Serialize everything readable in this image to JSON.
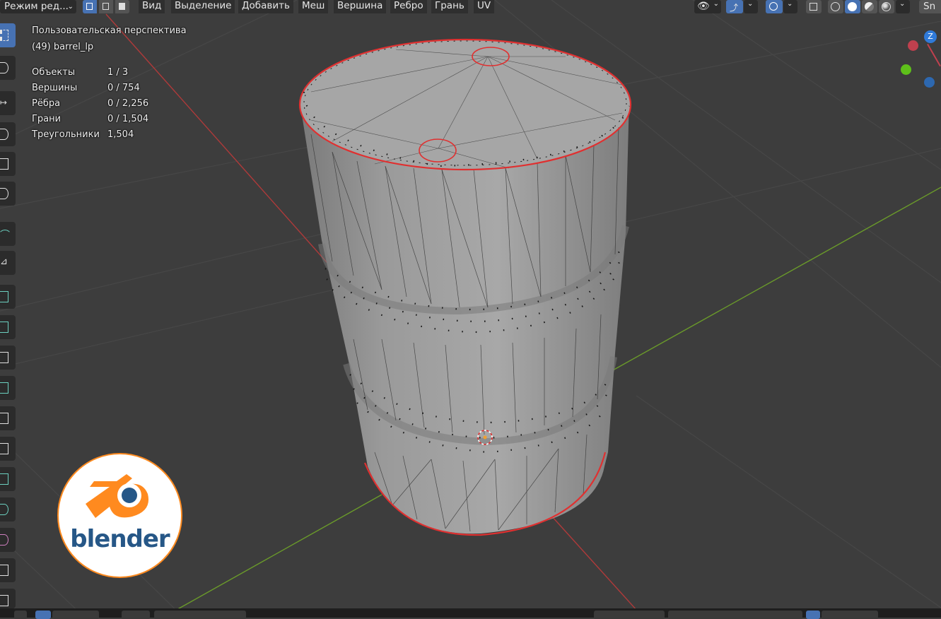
{
  "header": {
    "mode_dropdown": "Режим ред...",
    "menus": [
      "Вид",
      "Выделение",
      "Добавить",
      "Меш",
      "Вершина",
      "Ребро",
      "Грань",
      "UV"
    ],
    "snap_label": "Sn"
  },
  "overlay": {
    "view_name": "Пользовательская перспектива",
    "object_name": "(49) barrel_lp",
    "stats": [
      {
        "label": "Объекты",
        "value": "1 / 3"
      },
      {
        "label": "Вершины",
        "value": "0 / 754"
      },
      {
        "label": "Рёбра",
        "value": "0 / 2,256"
      },
      {
        "label": "Грани",
        "value": "0 / 1,504"
      },
      {
        "label": "Треугольники",
        "value": "1,504"
      }
    ]
  },
  "gizmo": {
    "z_label": "Z"
  },
  "logo": {
    "word": "blender"
  },
  "colors": {
    "viewport_bg": "#3d3d3d",
    "accent_blue": "#4772b3",
    "seam_red": "#e03030",
    "axis_x": "#b03a3a",
    "axis_y": "#6a9a2a",
    "mesh_gray": "#9a9a9a",
    "logo_orange": "#ff8a1f",
    "logo_blue": "#265787"
  },
  "icons": [
    "select-box-icon",
    "cursor-icon",
    "move-icon",
    "rotate-icon",
    "scale-icon",
    "transform-icon",
    "annotate-icon",
    "measure-icon",
    "add-cube-icon",
    "extrude-icon",
    "inset-icon",
    "bevel-icon",
    "loopcut-icon",
    "knife-icon",
    "polybuild-icon",
    "spin-icon",
    "smooth-icon",
    "shear-icon",
    "view-icon",
    "gizmo-icon",
    "overlay-icon",
    "xray-icon",
    "wireframe-shading-icon",
    "solid-shading-icon",
    "material-shading-icon",
    "rendered-shading-icon"
  ]
}
